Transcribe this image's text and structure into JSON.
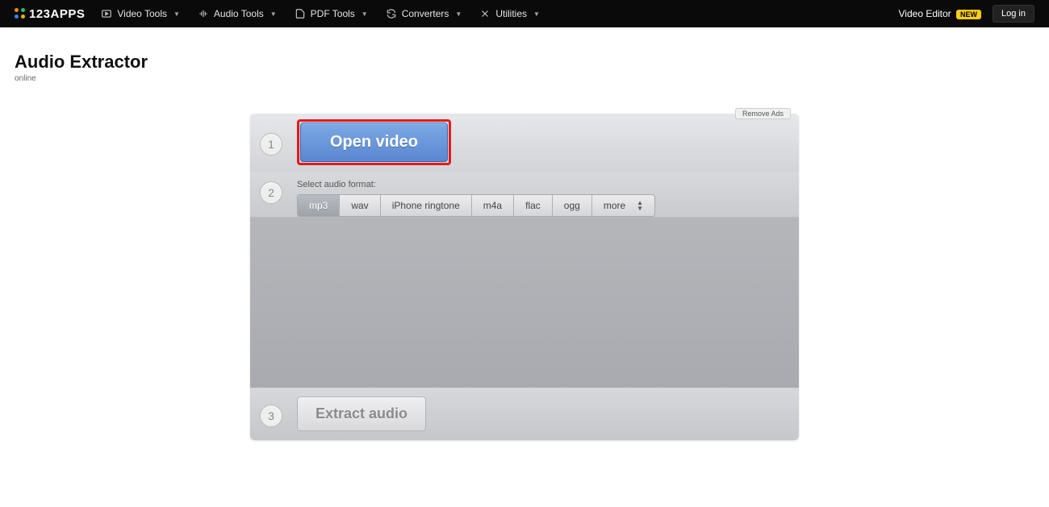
{
  "brand": "123APPS",
  "nav": {
    "video": "Video Tools",
    "audio": "Audio Tools",
    "pdf": "PDF Tools",
    "converters": "Converters",
    "utilities": "Utilities"
  },
  "video_editor": "Video Editor",
  "new_badge": "NEW",
  "login": "Log in",
  "page": {
    "title": "Audio Extractor",
    "subtitle": "online"
  },
  "remove_ads": "Remove Ads",
  "steps": {
    "s1": "1",
    "s2": "2",
    "s3": "3"
  },
  "open_video": "Open video",
  "format_label": "Select audio format:",
  "formats": [
    "mp3",
    "wav",
    "iPhone ringtone",
    "m4a",
    "flac",
    "ogg",
    "more"
  ],
  "extract": "Extract audio"
}
